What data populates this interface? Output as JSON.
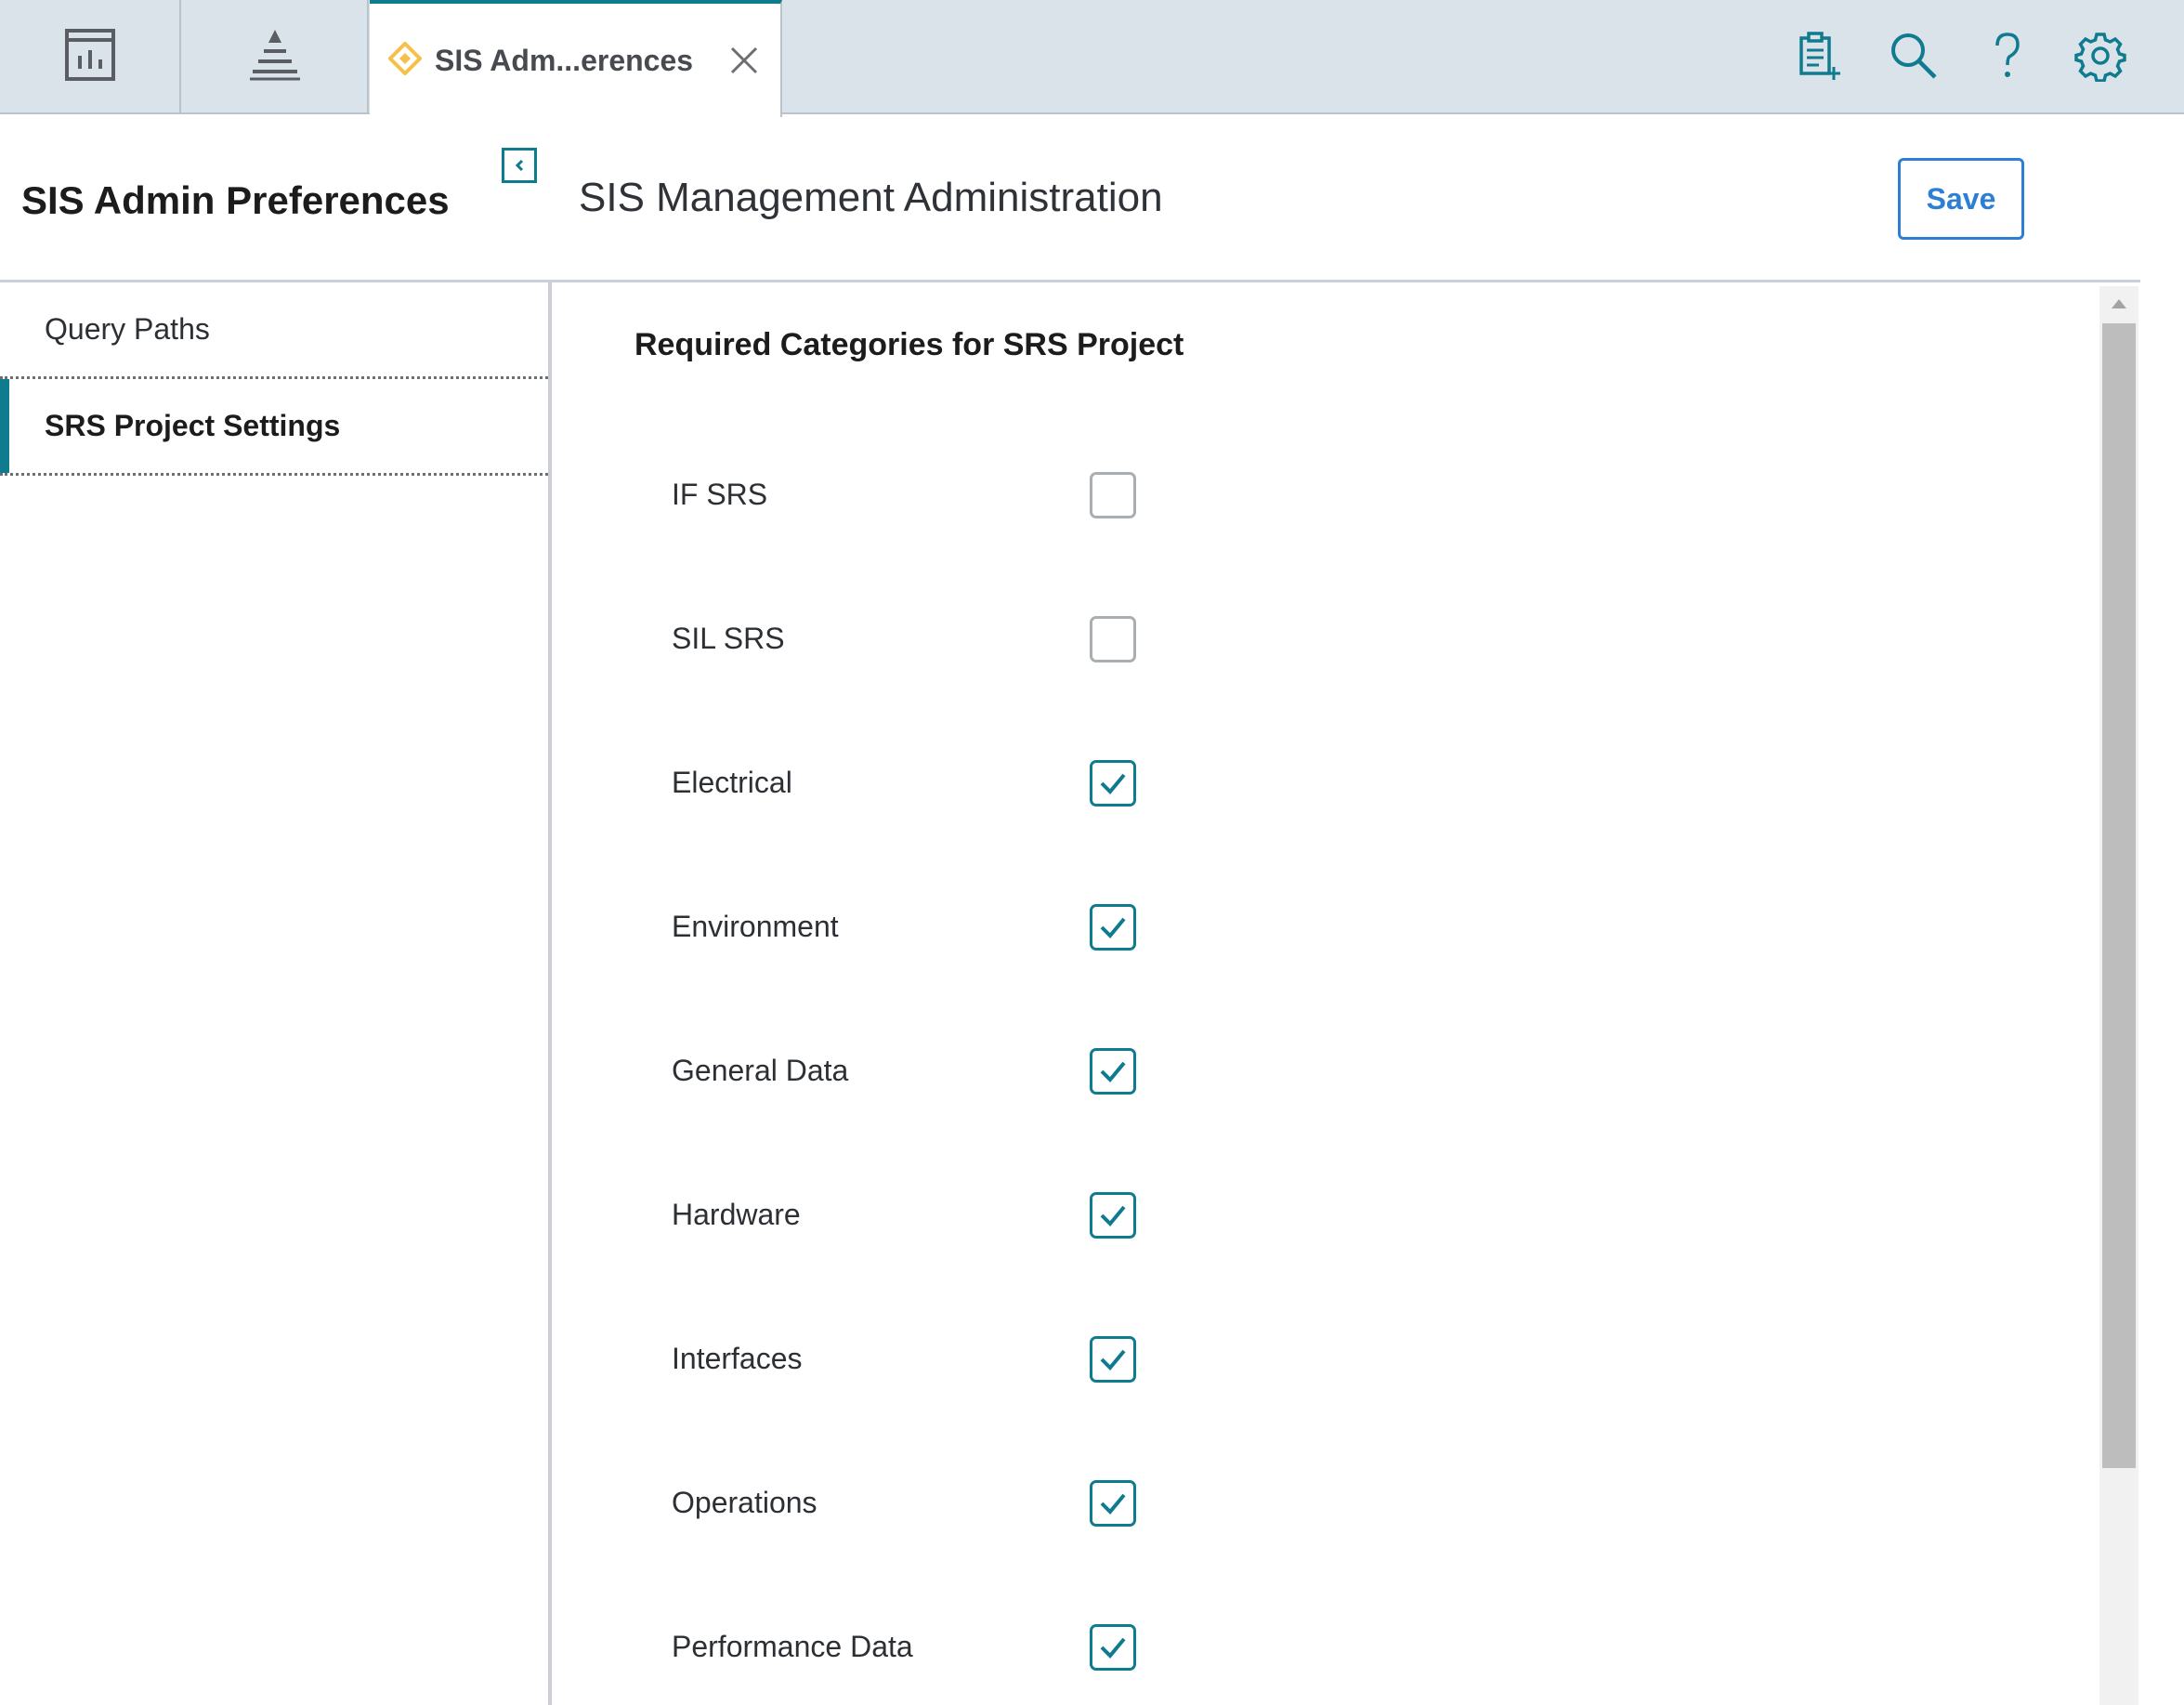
{
  "tabs": {
    "app_tab_1_icon": "dashboard-icon",
    "app_tab_2_icon": "hierarchy-pyramid-icon",
    "document_tab": {
      "title": "SIS Adm...erences",
      "icon": "diamond-icon",
      "close_icon": "close-icon"
    },
    "toolbar_icons": [
      "new-record-icon",
      "search-icon",
      "help-icon",
      "settings-gear-icon"
    ]
  },
  "header": {
    "page_title": "SIS Admin Preferences",
    "section_title": "SIS Management Administration",
    "save_label": "Save"
  },
  "sidebar": {
    "items": [
      {
        "label": "Query Paths",
        "active": false
      },
      {
        "label": "SRS Project Settings",
        "active": true
      }
    ]
  },
  "content": {
    "heading": "Required Categories for SRS Project",
    "categories": [
      {
        "label": "IF SRS",
        "checked": false
      },
      {
        "label": "SIL SRS",
        "checked": false
      },
      {
        "label": "Electrical",
        "checked": true
      },
      {
        "label": "Environment",
        "checked": true
      },
      {
        "label": "General Data",
        "checked": true
      },
      {
        "label": "Hardware",
        "checked": true
      },
      {
        "label": "Interfaces",
        "checked": true
      },
      {
        "label": "Operations",
        "checked": true
      },
      {
        "label": "Performance Data",
        "checked": true
      }
    ]
  },
  "colors": {
    "accent": "#0f7b8e",
    "save_blue": "#2c7fd3",
    "tabbar_bg": "#dbe3ea",
    "diamond": "#f6c04b"
  }
}
